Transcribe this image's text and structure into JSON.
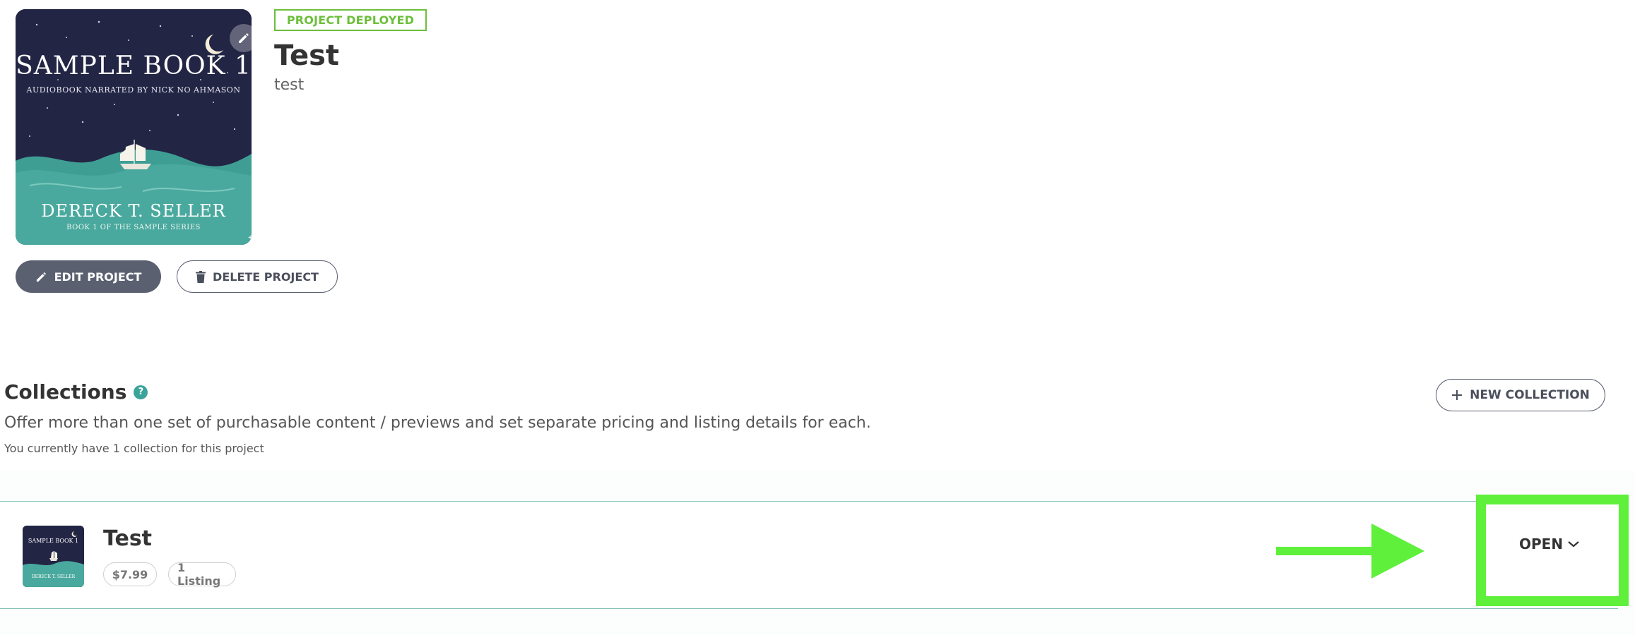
{
  "project": {
    "status": "PROJECT DEPLOYED",
    "title": "Test",
    "description": "test",
    "cover": {
      "title": "SAMPLE BOOK 1",
      "subtitle": "AUDIOBOOK NARRATED BY NICK NO AHMASON",
      "author": "DERECK T. SELLER",
      "series": "BOOK 1 OF THE SAMPLE SERIES"
    },
    "edit_label": "EDIT PROJECT",
    "delete_label": "DELETE PROJECT"
  },
  "collections": {
    "heading": "Collections",
    "help_glyph": "?",
    "description": "Offer more than one set of purchasable content / previews and set separate pricing and listing details for each.",
    "count_text": "You currently have 1 collection for this project",
    "new_label": "NEW COLLECTION",
    "items": [
      {
        "name": "Test",
        "price": "$7.99",
        "listings": "1 Listing",
        "open_label": "OPEN",
        "thumb_title": "SAMPLE BOOK 1",
        "thumb_author": "DERECK T. SELLER"
      }
    ]
  },
  "icons": {
    "edit": "pencil-icon",
    "delete": "trash-icon",
    "new": "plus-icon",
    "help": "question-icon",
    "open": "chevron-down-icon"
  },
  "colors": {
    "status_green": "#6cbf3a",
    "annotation_green": "#5ef03a",
    "help_teal": "#3aa39a",
    "row_border": "#86c2ba",
    "edit_button_bg": "#5a6070"
  }
}
